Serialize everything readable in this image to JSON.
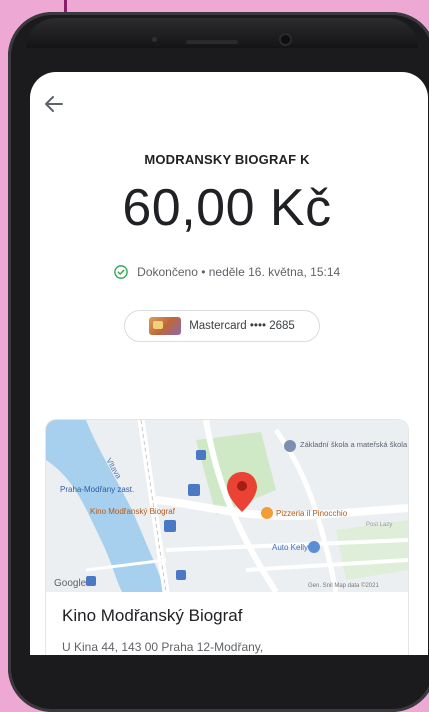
{
  "header": {
    "back_icon": "arrow-left-icon"
  },
  "transaction": {
    "merchant": "MODRANSKY BIOGRAF K",
    "amount": "60,00 Kč",
    "status_text": "Dokončeno • neděle 16. května, 15:14",
    "status_color": "#34a853"
  },
  "payment_method": {
    "label": "Mastercard •••• 2685"
  },
  "map": {
    "labels": {
      "place_marker": "Kino Modřanský Biograf",
      "tram_stop": "Praha-Modřany zast.",
      "school": "Základní škola a mateřská škola K...",
      "pizzeria": "Pizzeria il Pinocchio",
      "auto": "Auto Kelly",
      "river": "Vltava",
      "google": "Google",
      "footer": "Gen. Snil Map data ©2021",
      "post": "Post Lazy"
    },
    "marker_color": "#ea4335"
  },
  "place": {
    "name": "Kino Modřanský Biograf",
    "address": "U Kina 44, 143 00 Praha 12-Modřany,"
  }
}
